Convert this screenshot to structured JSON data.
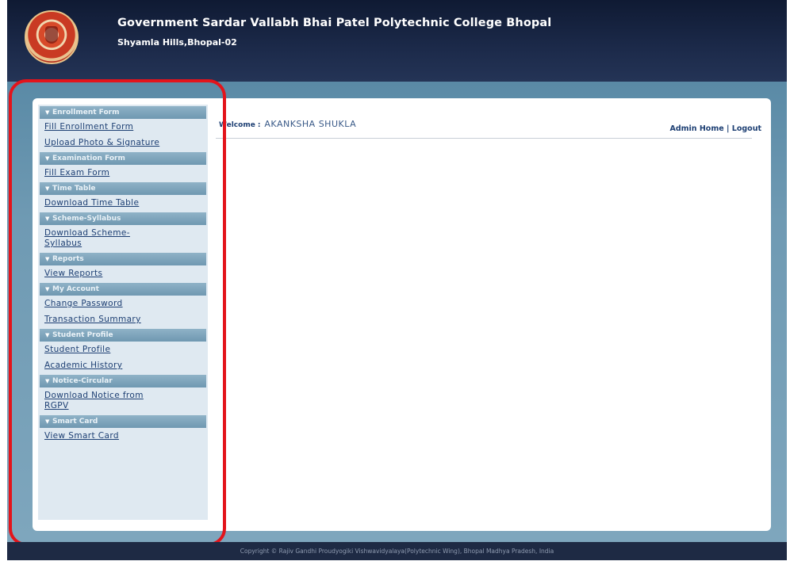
{
  "header": {
    "college_name": "Government Sardar Vallabh Bhai Patel Polytechnic College Bhopal",
    "address": "Shyamla Hills,Bhopal-02",
    "logo_icon": "college-emblem-icon"
  },
  "topnav": {
    "admin_home": "Admin Home",
    "separator": "|",
    "logout": "Logout"
  },
  "welcome": {
    "label": "Welcome :",
    "name": "AKANKSHA SHUKLA"
  },
  "sidebar": {
    "sections": [
      {
        "title": "Enrollment Form",
        "links": [
          "Fill Enrollment Form",
          "Upload Photo & Signature"
        ]
      },
      {
        "title": "Examination Form",
        "links": [
          "Fill Exam Form"
        ]
      },
      {
        "title": "Time Table",
        "links": [
          "Download Time Table"
        ]
      },
      {
        "title": "Scheme-Syllabus",
        "links": [
          "Download Scheme-Syllabus"
        ]
      },
      {
        "title": "Reports",
        "links": [
          "View Reports"
        ]
      },
      {
        "title": "My Account",
        "links": [
          "Change Password",
          "Transaction Summary"
        ]
      },
      {
        "title": "Student Profile",
        "links": [
          "Student Profile",
          "Academic History"
        ]
      },
      {
        "title": "Notice-Circular",
        "links": [
          "Download Notice from RGPV"
        ]
      },
      {
        "title": "Smart Card",
        "links": [
          "View Smart Card"
        ]
      }
    ]
  },
  "footer": {
    "text": "Copyright © Rajiv Gandhi Proudyogiki Vishwavidyalaya(Polytechnic Wing), Bhopal Madhya Pradesh, India"
  },
  "colors": {
    "header_bg": "#1c2a4a",
    "frame_bg": "#6f9ab3",
    "menu_header_bg": "#7fa4bb",
    "link": "#1d3f73",
    "highlight": "#e3141b"
  }
}
